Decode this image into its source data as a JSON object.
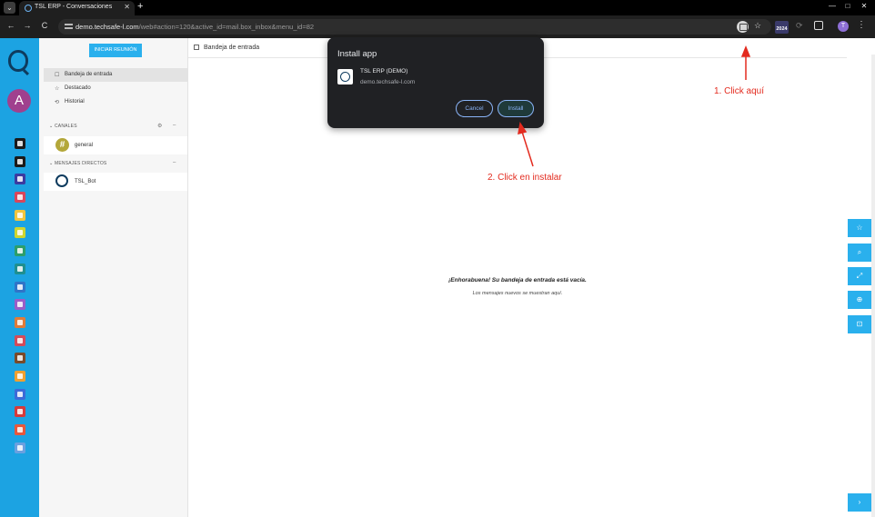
{
  "browser": {
    "tab_title": "TSL ERP - Conversaciones",
    "tab_close": "✕",
    "new_tab": "+",
    "url_host": "demo.techsafe-l.com",
    "url_path": "/web#action=120&active_id=mail.box_inbox&menu_id=82",
    "ext_badge": "2024",
    "profile_initial": "T",
    "window_minimize": "—",
    "window_maximize": "□",
    "window_close": "✕",
    "back": "←",
    "forward": "→",
    "reload": "C",
    "star": "☆",
    "kebab": "⋮",
    "tab_menu": "⌄"
  },
  "app": {
    "avatar_initial": "A",
    "start_meeting": "INICIAR REUNIÓN",
    "nav": [
      {
        "icon": "☐",
        "label": "Bandeja de entrada"
      },
      {
        "icon": "☆",
        "label": "Destacado"
      },
      {
        "icon": "⟲",
        "label": "Historial"
      }
    ],
    "channels_header": "CANALES",
    "channels": [
      {
        "label": "general"
      }
    ],
    "direct_header": "MENSAJES DIRECTOS",
    "directs": [
      {
        "label": "TSL_Bot"
      }
    ],
    "add_channel": "⚙",
    "section_toggle": "–",
    "main_title": "Bandeja de entrada",
    "empty_title": "¡Enhorabuena! Su bandeja de entrada está vacía.",
    "empty_sub": "Los mensajes nuevos se muestran aquí.",
    "right_buttons": [
      "☆",
      "⌕",
      "⤢",
      "⊕",
      "⊡"
    ],
    "bottom_right_button": "›",
    "app_icon_colors": [
      "#1a1a1a",
      "#1a1a1a",
      "#3b3ba0",
      "#d9465b",
      "#f2c53d",
      "#cfd62f",
      "#2c9e6b",
      "#1f8f8f",
      "#2f74c8",
      "#9a5dc8",
      "#e07b39",
      "#d34b5a",
      "#7a4a2a",
      "#f0a030",
      "#3c6ad8",
      "#d63a3a",
      "#e8573a",
      "#6aa0e0"
    ]
  },
  "dialog": {
    "title": "Install app",
    "app_name": "TSL ERP (DEMO)",
    "app_url": "demo.techsafe-l.com",
    "cancel": "Cancel",
    "install": "Install"
  },
  "annotations": {
    "step1": "1. Click aquí",
    "step2": "2. Click en instalar",
    "color": "#e32b1f"
  }
}
